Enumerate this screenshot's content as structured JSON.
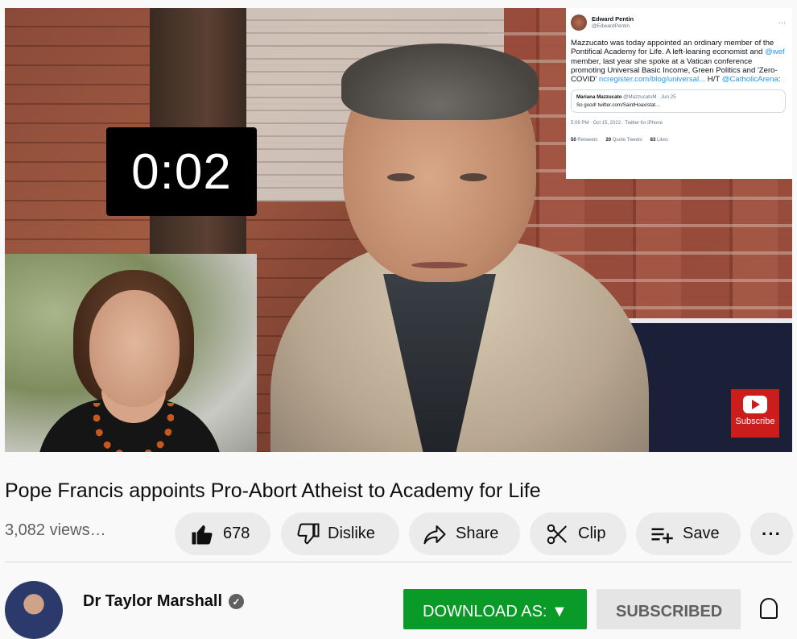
{
  "video": {
    "timer": "0:02",
    "tweet": {
      "name": "Edward Pentin",
      "handle": "@EdwardPentin",
      "more": "···",
      "body_1": "Mazzucato was today appointed an ordinary member of the Pontifical Academy for Life. A left-leaning economist and ",
      "mention_wef": "@wef",
      "body_2": " member, last year she spoke at a Vatican conference promoting Universal Basic Income, Green Politics and 'Zero-COVID'",
      "link": "ncregister.com/blog/universal...",
      "ht": " H/T ",
      "mention_arena": "@CatholicArena",
      "colon": ":",
      "quote_name": "Mariana Mazzucato",
      "quote_handle": "@MazzucatoM · Jun 25",
      "quote_text": "So good! twitter.com/SaintHoax/stat...",
      "meta": "5:09 PM · Oct 15, 2022 · Twitter for iPhone",
      "retweets_count": "50",
      "retweets_label": "Retweets",
      "quotes_count": "20",
      "quotes_label": "Quote Tweets",
      "likes_count": "83",
      "likes_label": "Likes"
    },
    "subscribe_badge": "Subscribe"
  },
  "title": "Pope Francis appoints Pro-Abort Atheist to Academy for Life",
  "views": "3,082 views…",
  "actions": {
    "like_count": "678",
    "dislike_label": "Dislike",
    "share_label": "Share",
    "clip_label": "Clip",
    "save_label": "Save",
    "more_label": "···"
  },
  "channel": {
    "name": "Dr Taylor Marshall",
    "verified_mark": "✓",
    "download_label": "DOWNLOAD AS: ▼",
    "subscribed_label": "SUBSCRIBED"
  },
  "icons": [
    "thumbs-up-icon",
    "thumbs-down-icon",
    "share-icon",
    "scissors-icon",
    "playlist-add-icon",
    "more-icon",
    "verified-icon",
    "bell-icon",
    "youtube-play-icon"
  ],
  "colors": {
    "download": "#0a9a27",
    "yt_red": "#cc1d1d",
    "link": "#1d9bf0"
  }
}
